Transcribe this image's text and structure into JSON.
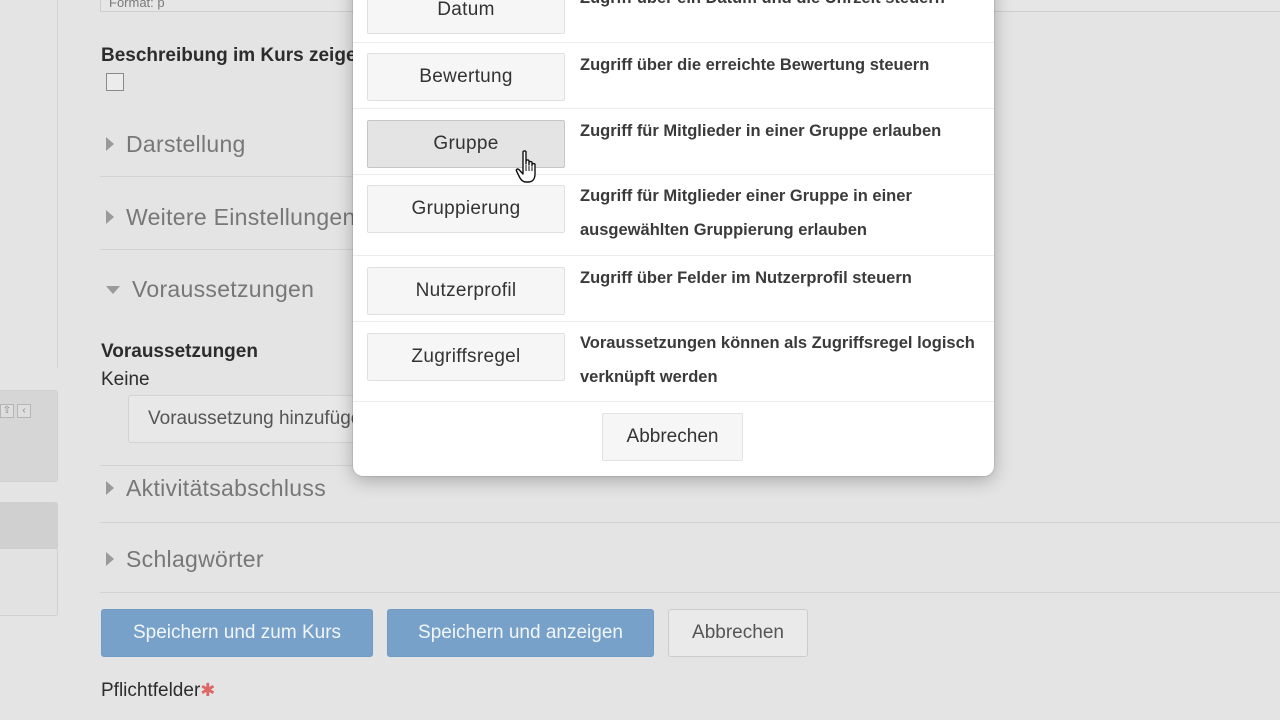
{
  "form": {
    "format_label": "Format: p",
    "show_description_label": "Beschreibung im Kurs zeigen",
    "sections": {
      "darstellung": "Darstellung",
      "weitere": "Weitere Einstellungen",
      "voraussetzungen": "Voraussetzungen",
      "aktivitaet": "Aktivitätsabschluss",
      "schlagwoerter": "Schlagwörter"
    },
    "restrictions_heading": "Voraussetzungen",
    "restrictions_value": "Keine",
    "add_restriction_button": "Voraussetzung hinzufügen...",
    "buttons": {
      "save_return": "Speichern und zum Kurs",
      "save_display": "Speichern und anzeigen",
      "cancel": "Abbrechen"
    },
    "required_fields": "Pflichtfelder",
    "required_marker": "✱"
  },
  "modal": {
    "options": [
      {
        "label": "Datum",
        "description": "Zugriff über ein Datum und die Uhrzeit steuern"
      },
      {
        "label": "Bewertung",
        "description": "Zugriff über die erreichte Bewertung steuern"
      },
      {
        "label": "Gruppe",
        "description": "Zugriff für Mitglieder in einer Gruppe erlauben"
      },
      {
        "label": "Gruppierung",
        "description": "Zugriff für Mitglieder einer Gruppe in einer ausgewählten Gruppierung erlauben"
      },
      {
        "label": "Nutzerprofil",
        "description": "Zugriff über Felder im Nutzerprofil steuern"
      },
      {
        "label": "Zugriffsregel",
        "description": "Voraussetzungen können als Zugriffsregel logisch verknüpft werden"
      }
    ],
    "cancel_label": "Abbrechen"
  },
  "colors": {
    "primary_button": "#77a1c9",
    "background": "#e4e4e4",
    "required_star": "#e06666"
  },
  "icons": {
    "expand_section": "triangle-right",
    "collapse_section": "triangle-down",
    "cursor": "hand-pointer"
  }
}
